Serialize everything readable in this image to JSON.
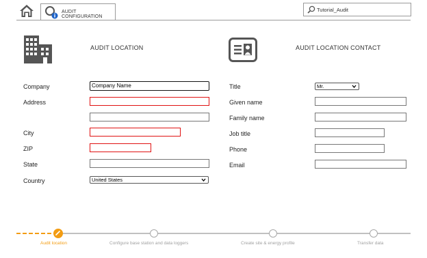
{
  "toolbar": {
    "tab_label": "AUDIT CONFIGURATION",
    "project_name": "Tutorial_Audit"
  },
  "audit_location": {
    "title": "AUDIT LOCATION",
    "company_label": "Company",
    "company_value": "Company Name",
    "address_label": "Address",
    "city_label": "City",
    "zip_label": "ZIP",
    "state_label": "State",
    "country_label": "Country",
    "country_value": "United States"
  },
  "contact": {
    "title": "AUDIT LOCATION CONTACT",
    "title_label": "Title",
    "title_value": "Mr.",
    "given_name_label": "Given name",
    "family_name_label": "Family name",
    "job_title_label": "Job title",
    "phone_label": "Phone",
    "email_label": "Email"
  },
  "stepper": {
    "steps": [
      {
        "label": "Audit location",
        "active": true
      },
      {
        "label": "Configure base station and data loggers",
        "active": false
      },
      {
        "label": "Create site & energy profile",
        "active": false
      },
      {
        "label": "Transfer data",
        "active": false
      }
    ]
  },
  "colors": {
    "accent": "#f39c12",
    "error": "#e01010",
    "icon_gray": "#555555"
  },
  "icons": [
    "home-icon",
    "magnifier-info-icon",
    "search-icon",
    "building-icon",
    "contact-card-icon",
    "edit-pencil-icon"
  ]
}
